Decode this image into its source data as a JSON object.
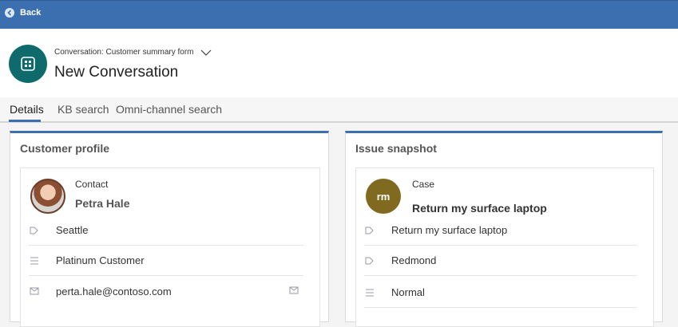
{
  "topbar": {
    "back_label": "Back"
  },
  "header": {
    "form_name": "Conversation: Customer summary form",
    "title": "New Conversation"
  },
  "tabs": [
    {
      "label": "Details"
    },
    {
      "label": "KB search"
    },
    {
      "label": "Omni-channel search"
    }
  ],
  "customer_profile": {
    "title": "Customer profile",
    "type_label": "Contact",
    "name": "Petra Hale",
    "rows": [
      {
        "icon": "address-icon",
        "text": "Seattle"
      },
      {
        "icon": "list-icon",
        "text": "Platinum Customer"
      },
      {
        "icon": "email-icon",
        "text": "perta.hale@contoso.com"
      }
    ]
  },
  "issue_snapshot": {
    "title": "Issue snapshot",
    "avatar_initials": "rm",
    "type_label": "Case",
    "name": "Return my surface laptop",
    "rows": [
      {
        "icon": "address-icon",
        "text": "Return my surface laptop"
      },
      {
        "icon": "address-icon",
        "text": "Redmond"
      },
      {
        "icon": "list-icon",
        "text": "Normal"
      }
    ]
  }
}
